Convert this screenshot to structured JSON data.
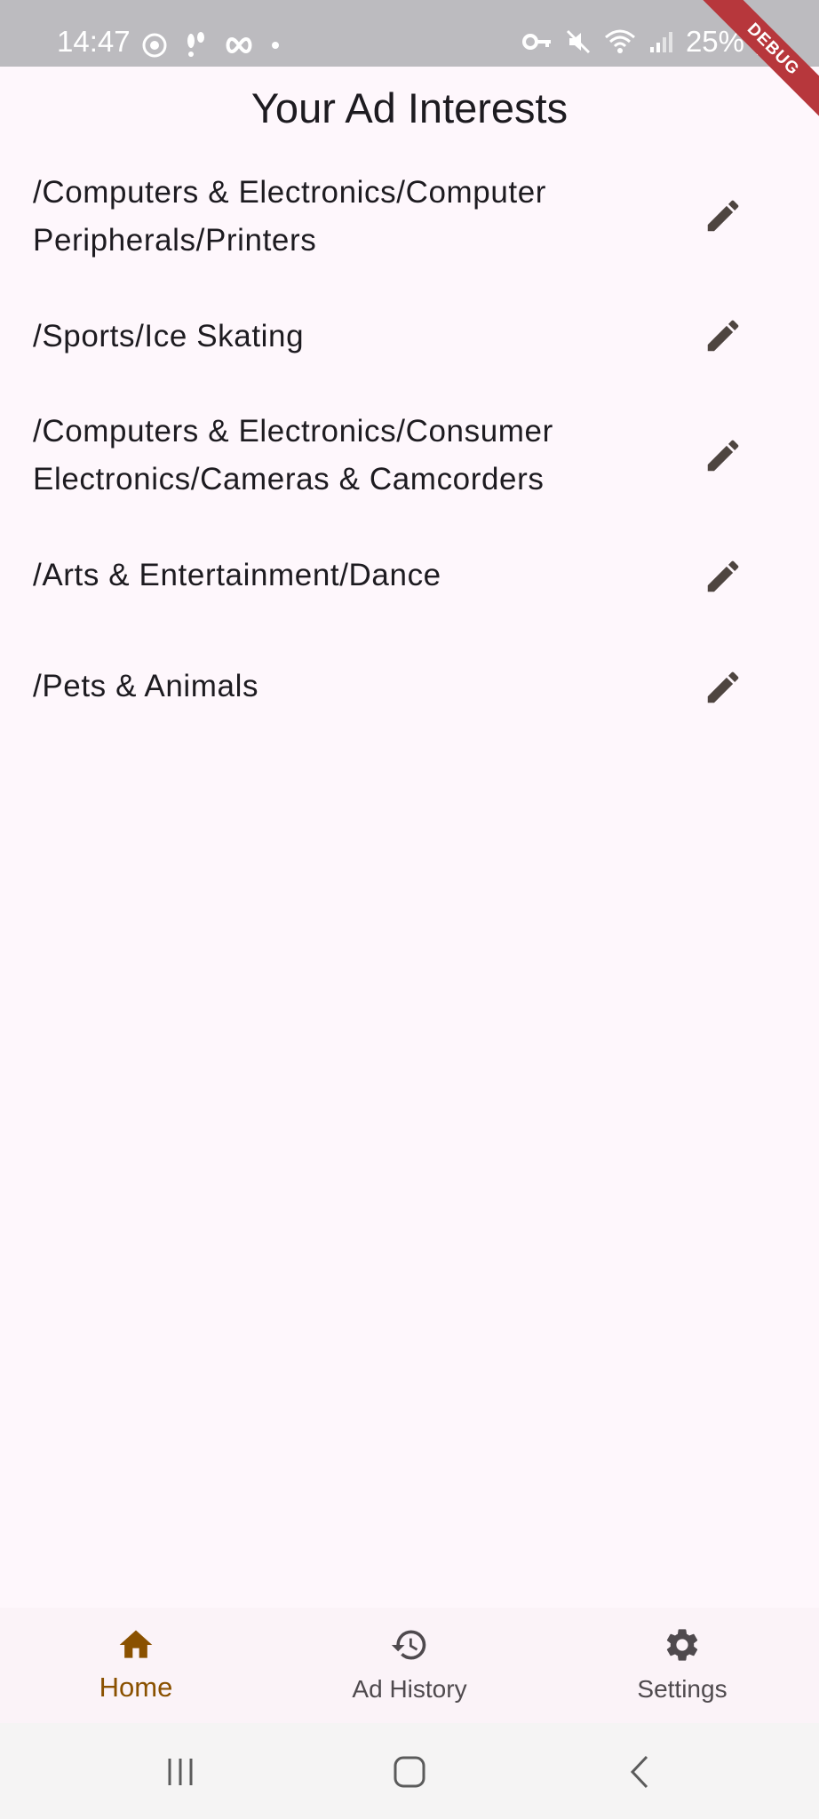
{
  "status_bar": {
    "time": "14:47",
    "battery_text": "25%",
    "debug_label": "DEBUG"
  },
  "page": {
    "title": "Your Ad Interests"
  },
  "interests": [
    {
      "label": "/Computers & Electronics/Computer Peripherals/Printers",
      "icon": "edit-icon"
    },
    {
      "label": "/Sports/Ice Skating",
      "icon": "edit-icon"
    },
    {
      "label": "/Computers & Electronics/Consumer Electronics/Cameras & Camcorders",
      "icon": "edit-icon"
    },
    {
      "label": "/Arts & Entertainment/Dance",
      "icon": "edit-icon"
    },
    {
      "label": "/Pets & Animals",
      "icon": "edit-icon"
    }
  ],
  "bottom_nav": {
    "items": [
      {
        "label": "Home",
        "icon": "home-icon",
        "active": true
      },
      {
        "label": "Ad History",
        "icon": "history-icon",
        "active": false
      },
      {
        "label": "Settings",
        "icon": "gear-icon",
        "active": false
      }
    ]
  },
  "colors": {
    "background": "#fef7fc",
    "accent": "#8a5100",
    "icon": "#4e4540",
    "status_bar": "#bcbbbf",
    "debug_ribbon": "#b7373c"
  }
}
